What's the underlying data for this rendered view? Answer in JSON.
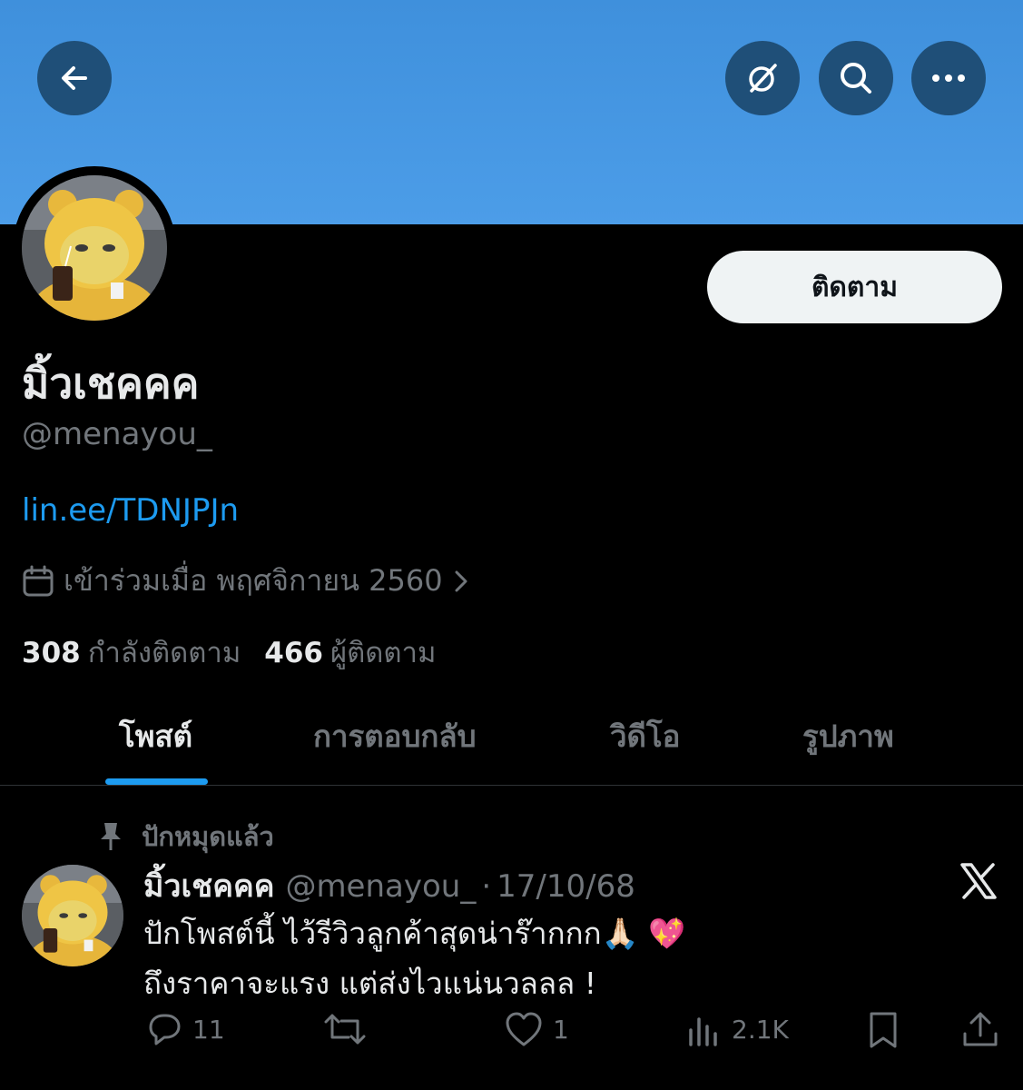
{
  "profile": {
    "display_name": "มิ้วเชคคค",
    "handle": "@menayou_",
    "link": "lin.ee/TDNJPJn",
    "joined": "เข้าร่วมเมื่อ พฤศจิกายน 2560",
    "follow_label": "ติดตาม",
    "following_count": "308",
    "following_label": "กำลังติดตาม",
    "followers_count": "466",
    "followers_label": "ผู้ติดตาม"
  },
  "tabs": [
    {
      "label": "โพสต์",
      "active": true
    },
    {
      "label": "การตอบกลับ",
      "active": false
    },
    {
      "label": "วิดีโอ",
      "active": false
    },
    {
      "label": "รูปภาพ",
      "active": false
    }
  ],
  "post": {
    "pinned_label": "ปักหมุดแล้ว",
    "name": "มิ้วเชคคค",
    "handle": "@menayou_",
    "separator": "·",
    "date": "17/10/68",
    "line1": "ปักโพสต์นี้ ไว้รีวิวลูกค้าสุดน่าร๊ากกก🙏🏻 💖",
    "line2": "ถึงราคาจะแรง แต่ส่งไวแน่นวลลล !",
    "replies": "11",
    "reposts": "",
    "likes": "1",
    "views": "2.1K"
  },
  "icons": {
    "back": "arrow-left-icon",
    "grok": "grok-icon",
    "search": "search-icon",
    "more": "more-icon",
    "calendar": "calendar-icon",
    "pin": "pin-icon",
    "x": "x-logo-icon"
  },
  "colors": {
    "banner": "#4c9de8",
    "accent": "#1d9bf0",
    "secondary_text": "#71767b",
    "primary_text": "#e7e9ea",
    "background": "#000000"
  }
}
